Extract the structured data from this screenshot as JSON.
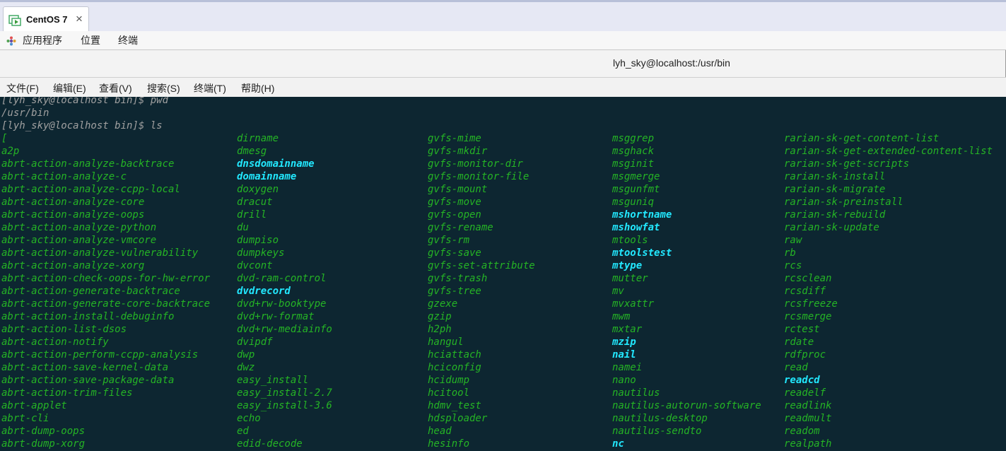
{
  "tab": {
    "title": "CentOS 7",
    "close_glyph": "×",
    "icon": "vm-icon"
  },
  "top_menu": [
    {
      "label": "应用程序",
      "icon": "apps-icon"
    },
    {
      "label": "位置"
    },
    {
      "label": "终端"
    }
  ],
  "window": {
    "title": "lyh_sky@localhost:/usr/bin"
  },
  "terminal_menu": [
    {
      "label": "文件(F)"
    },
    {
      "label": "编辑(E)"
    },
    {
      "label": "查看(V)"
    },
    {
      "label": "搜索(S)"
    },
    {
      "label": "终端(T)"
    },
    {
      "label": "帮助(H)"
    }
  ],
  "terminal": {
    "lines": [
      "[lyh_sky@localhost bin]$ pwd",
      "/usr/bin",
      "[lyh_sky@localhost bin]$ ls"
    ],
    "colors": {
      "background": "#0d2631",
      "file": "#25b425",
      "highlight": "#22e8ff",
      "prompt": "#a0a0a0"
    },
    "columns": [
      [
        {
          "name": "["
        },
        {
          "name": "a2p"
        },
        {
          "name": "abrt-action-analyze-backtrace"
        },
        {
          "name": "abrt-action-analyze-c"
        },
        {
          "name": "abrt-action-analyze-ccpp-local"
        },
        {
          "name": "abrt-action-analyze-core"
        },
        {
          "name": "abrt-action-analyze-oops"
        },
        {
          "name": "abrt-action-analyze-python"
        },
        {
          "name": "abrt-action-analyze-vmcore"
        },
        {
          "name": "abrt-action-analyze-vulnerability"
        },
        {
          "name": "abrt-action-analyze-xorg"
        },
        {
          "name": "abrt-action-check-oops-for-hw-error"
        },
        {
          "name": "abrt-action-generate-backtrace"
        },
        {
          "name": "abrt-action-generate-core-backtrace"
        },
        {
          "name": "abrt-action-install-debuginfo"
        },
        {
          "name": "abrt-action-list-dsos"
        },
        {
          "name": "abrt-action-notify"
        },
        {
          "name": "abrt-action-perform-ccpp-analysis"
        },
        {
          "name": "abrt-action-save-kernel-data"
        },
        {
          "name": "abrt-action-save-package-data"
        },
        {
          "name": "abrt-action-trim-files"
        },
        {
          "name": "abrt-applet"
        },
        {
          "name": "abrt-cli"
        },
        {
          "name": "abrt-dump-oops"
        },
        {
          "name": "abrt-dump-xorg"
        }
      ],
      [
        {
          "name": "dirname"
        },
        {
          "name": "dmesg"
        },
        {
          "name": "dnsdomainname",
          "highlight": true
        },
        {
          "name": "domainname",
          "highlight": true
        },
        {
          "name": "doxygen"
        },
        {
          "name": "dracut"
        },
        {
          "name": "drill"
        },
        {
          "name": "du"
        },
        {
          "name": "dumpiso"
        },
        {
          "name": "dumpkeys"
        },
        {
          "name": "dvcont"
        },
        {
          "name": "dvd-ram-control"
        },
        {
          "name": "dvdrecord",
          "highlight": true
        },
        {
          "name": "dvd+rw-booktype"
        },
        {
          "name": "dvd+rw-format"
        },
        {
          "name": "dvd+rw-mediainfo"
        },
        {
          "name": "dvipdf"
        },
        {
          "name": "dwp"
        },
        {
          "name": "dwz"
        },
        {
          "name": "easy_install"
        },
        {
          "name": "easy_install-2.7"
        },
        {
          "name": "easy_install-3.6"
        },
        {
          "name": "echo"
        },
        {
          "name": "ed"
        },
        {
          "name": "edid-decode"
        }
      ],
      [
        {
          "name": "gvfs-mime"
        },
        {
          "name": "gvfs-mkdir"
        },
        {
          "name": "gvfs-monitor-dir"
        },
        {
          "name": "gvfs-monitor-file"
        },
        {
          "name": "gvfs-mount"
        },
        {
          "name": "gvfs-move"
        },
        {
          "name": "gvfs-open"
        },
        {
          "name": "gvfs-rename"
        },
        {
          "name": "gvfs-rm"
        },
        {
          "name": "gvfs-save"
        },
        {
          "name": "gvfs-set-attribute"
        },
        {
          "name": "gvfs-trash"
        },
        {
          "name": "gvfs-tree"
        },
        {
          "name": "gzexe"
        },
        {
          "name": "gzip"
        },
        {
          "name": "h2ph"
        },
        {
          "name": "hangul"
        },
        {
          "name": "hciattach"
        },
        {
          "name": "hciconfig"
        },
        {
          "name": "hcidump"
        },
        {
          "name": "hcitool"
        },
        {
          "name": "hdmv_test"
        },
        {
          "name": "hdsploader"
        },
        {
          "name": "head"
        },
        {
          "name": "hesinfo"
        }
      ],
      [
        {
          "name": "msggrep"
        },
        {
          "name": "msghack"
        },
        {
          "name": "msginit"
        },
        {
          "name": "msgmerge"
        },
        {
          "name": "msgunfmt"
        },
        {
          "name": "msguniq"
        },
        {
          "name": "mshortname",
          "highlight": true
        },
        {
          "name": "mshowfat",
          "highlight": true
        },
        {
          "name": "mtools"
        },
        {
          "name": "mtoolstest",
          "highlight": true
        },
        {
          "name": "mtype",
          "highlight": true
        },
        {
          "name": "mutter"
        },
        {
          "name": "mv"
        },
        {
          "name": "mvxattr"
        },
        {
          "name": "mwm"
        },
        {
          "name": "mxtar"
        },
        {
          "name": "mzip",
          "highlight": true
        },
        {
          "name": "nail",
          "highlight": true
        },
        {
          "name": "namei"
        },
        {
          "name": "nano"
        },
        {
          "name": "nautilus"
        },
        {
          "name": "nautilus-autorun-software"
        },
        {
          "name": "nautilus-desktop"
        },
        {
          "name": "nautilus-sendto"
        },
        {
          "name": "nc",
          "highlight": true
        }
      ],
      [
        {
          "name": "rarian-sk-get-content-list"
        },
        {
          "name": "rarian-sk-get-extended-content-list"
        },
        {
          "name": "rarian-sk-get-scripts"
        },
        {
          "name": "rarian-sk-install"
        },
        {
          "name": "rarian-sk-migrate"
        },
        {
          "name": "rarian-sk-preinstall"
        },
        {
          "name": "rarian-sk-rebuild"
        },
        {
          "name": "rarian-sk-update"
        },
        {
          "name": "raw"
        },
        {
          "name": "rb"
        },
        {
          "name": "rcs"
        },
        {
          "name": "rcsclean"
        },
        {
          "name": "rcsdiff"
        },
        {
          "name": "rcsfreeze"
        },
        {
          "name": "rcsmerge"
        },
        {
          "name": "rctest"
        },
        {
          "name": "rdate"
        },
        {
          "name": "rdfproc"
        },
        {
          "name": "read"
        },
        {
          "name": "readcd",
          "highlight": true
        },
        {
          "name": "readelf"
        },
        {
          "name": "readlink"
        },
        {
          "name": "readmult"
        },
        {
          "name": "readom"
        },
        {
          "name": "realpath"
        }
      ]
    ]
  }
}
